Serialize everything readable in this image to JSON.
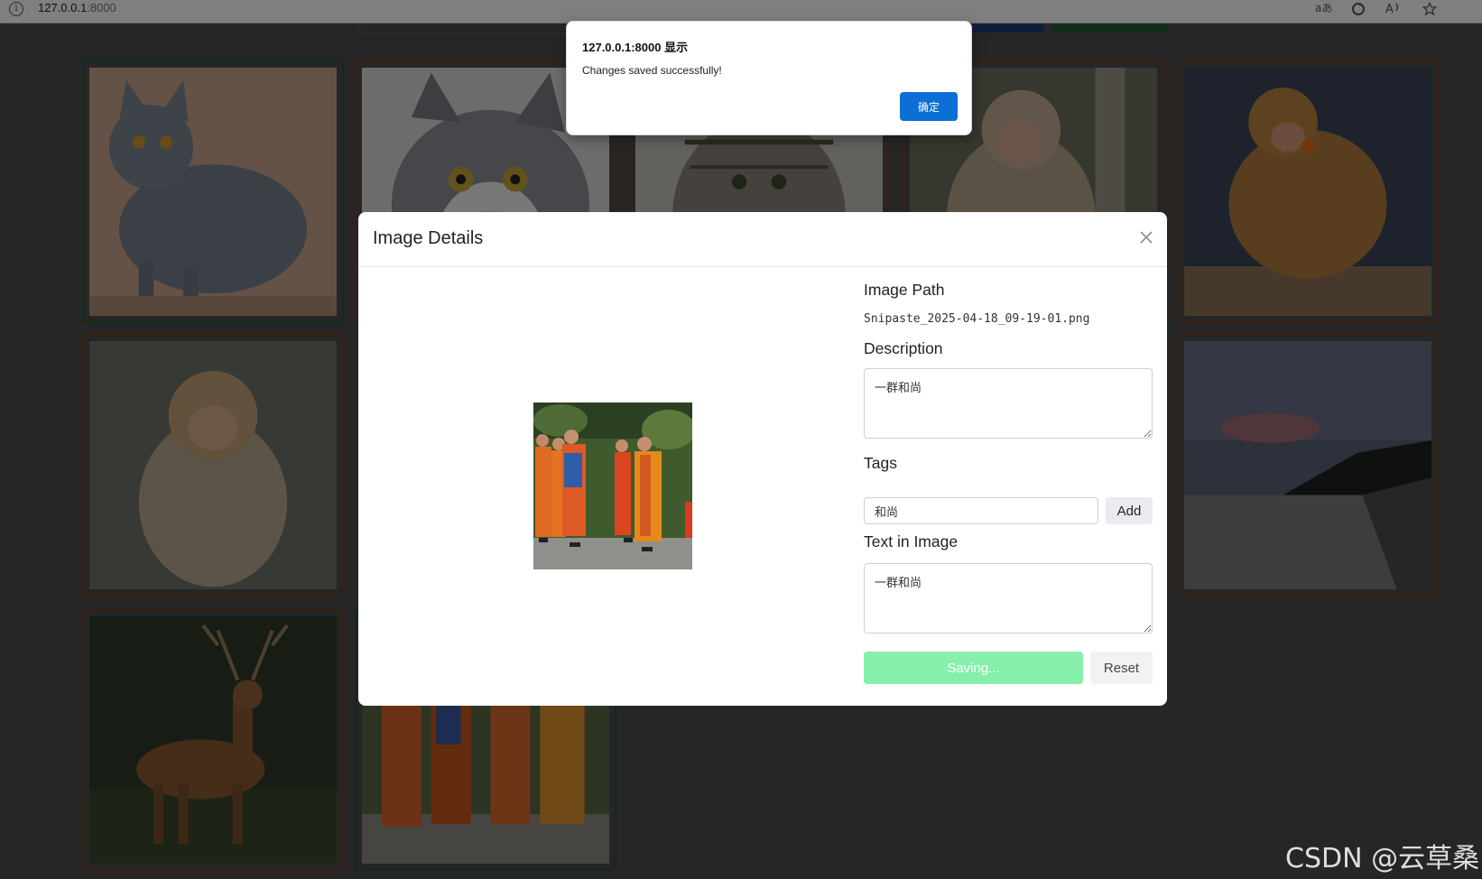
{
  "browser": {
    "url_host": "127.0.0.1",
    "url_port": ":8000"
  },
  "gallery": {
    "items": [
      {
        "subject": "gray cat",
        "border": "green"
      },
      {
        "subject": "gray and white cat",
        "border": "brown"
      },
      {
        "subject": "tabby cat",
        "border": "brown"
      },
      {
        "subject": "macaque on branch",
        "border": "brown"
      },
      {
        "subject": "macaque eating",
        "border": "brown"
      },
      {
        "subject": "young macaque",
        "border": "brown"
      },
      {
        "subject": "beach at dusk",
        "border": "brown"
      },
      {
        "subject": "red deer",
        "border": "brown"
      },
      {
        "subject": "monks walking",
        "border": "green"
      }
    ]
  },
  "modal": {
    "title": "Image Details",
    "image_path_label": "Image Path",
    "image_path": "Snipaste_2025-04-18_09-19-01.png",
    "description_label": "Description",
    "description": "一群和尚",
    "tags_label": "Tags",
    "tag_input_value": "和尚",
    "add_label": "Add",
    "text_label": "Text in Image",
    "text_in_image": "一群和尚",
    "saving_label": "Saving...",
    "reset_label": "Reset"
  },
  "alert": {
    "title": "127.0.0.1:8000 显示",
    "message": "Changes saved successfully!",
    "ok_label": "确定"
  },
  "watermark": "CSDN @云草桑",
  "colors": {
    "saving_button": "#86efac",
    "alert_ok": "#0b6fd6",
    "card_border_brown": "#7a3f1c",
    "card_border_green": "#1f5a34"
  }
}
